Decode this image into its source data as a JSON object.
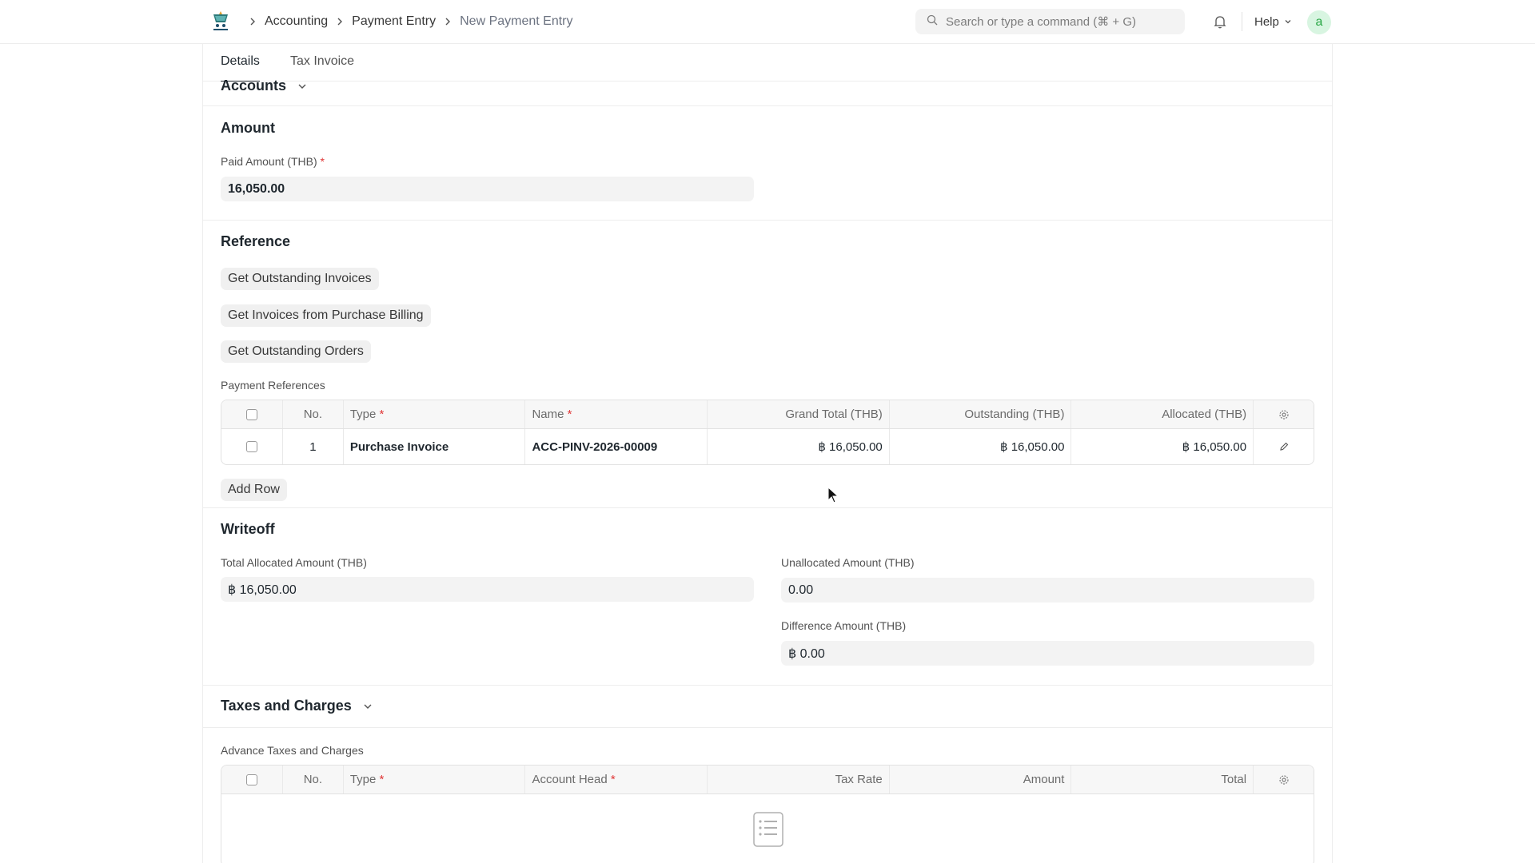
{
  "navbar": {
    "breadcrumbs": [
      "Accounting",
      "Payment Entry",
      "New Payment Entry"
    ],
    "search_placeholder": "Search or type a command (⌘ + G)",
    "help_label": "Help",
    "avatar_initial": "a"
  },
  "tabs": [
    {
      "label": "Details",
      "active": true
    },
    {
      "label": "Tax Invoice",
      "active": false
    }
  ],
  "sections": {
    "accounts_title": "Accounts",
    "amount": {
      "title": "Amount",
      "paid_amount_label": "Paid Amount (THB)",
      "paid_amount_value": "16,050.00"
    },
    "reference": {
      "title": "Reference",
      "buttons": [
        "Get Outstanding Invoices",
        "Get Invoices from Purchase Billing",
        "Get Outstanding Orders"
      ],
      "table_label": "Payment References",
      "columns": [
        "No.",
        "Type",
        "Name",
        "Grand Total (THB)",
        "Outstanding (THB)",
        "Allocated (THB)"
      ],
      "rows": [
        {
          "no": "1",
          "type": "Purchase Invoice",
          "name": "ACC-PINV-2026-00009",
          "grand_total": "฿ 16,050.00",
          "outstanding": "฿ 16,050.00",
          "allocated": "฿ 16,050.00"
        }
      ],
      "add_row_label": "Add Row"
    },
    "writeoff": {
      "title": "Writeoff",
      "total_allocated_label": "Total Allocated Amount (THB)",
      "total_allocated_value": "฿ 16,050.00",
      "unallocated_label": "Unallocated Amount (THB)",
      "unallocated_value": "0.00",
      "difference_label": "Difference Amount (THB)",
      "difference_value": "฿ 0.00"
    },
    "taxes": {
      "title": "Taxes and Charges",
      "table_label": "Advance Taxes and Charges",
      "columns": [
        "No.",
        "Type",
        "Account Head",
        "Tax Rate",
        "Amount",
        "Total"
      ]
    }
  },
  "colors": {
    "accent_required": "#e03636",
    "avatar_bg": "#d8f5e1",
    "avatar_fg": "#28a745"
  }
}
